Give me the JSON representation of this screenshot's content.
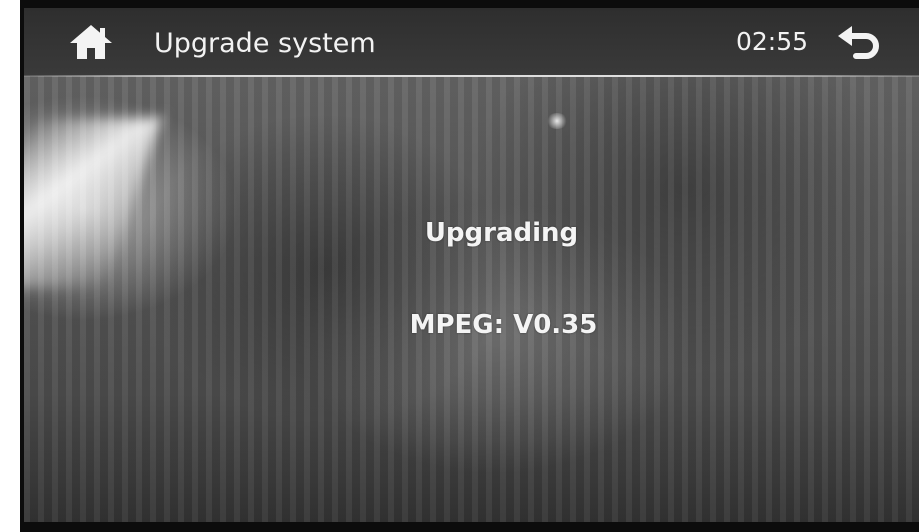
{
  "header": {
    "title": "Upgrade system",
    "clock": "02:55",
    "home_icon": "home-icon",
    "back_icon": "back-arrow-icon"
  },
  "main": {
    "status": "Upgrading",
    "version": "MPEG: V0.35"
  }
}
